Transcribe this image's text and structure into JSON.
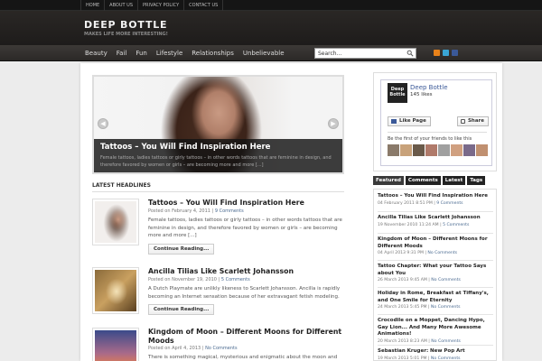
{
  "topnav": {
    "items": [
      "HOME",
      "ABOUT US",
      "PRIVACY POLICY",
      "CONTACT US"
    ]
  },
  "header": {
    "title": "DEEP BOTTLE",
    "tagline": "MAKES LIFE MORE INTERESTING!"
  },
  "mainnav": {
    "items": [
      "Beauty",
      "Fail",
      "Fun",
      "Lifestyle",
      "Relationships",
      "Unbelievable"
    ]
  },
  "search": {
    "placeholder": "Search..."
  },
  "social": {
    "icons": [
      "rss-icon",
      "twitter-icon",
      "facebook-icon"
    ],
    "colors": [
      "#e8821a",
      "#3aa6d6",
      "#3b5998"
    ]
  },
  "slider": {
    "title": "Tattoos – You Will Find Inspiration Here",
    "excerpt": "Female tattoos, ladies tattoos or girly tattoos – in other words tattoos that are feminine in design, and therefore favored by women or girls – are becoming more and more [...]"
  },
  "latest": {
    "heading": "LATEST HEADLINES"
  },
  "posts": [
    {
      "title": "Tattoos – You Will Find Inspiration Here",
      "date": "Posted on February 4, 2011",
      "comments": "9 Comments",
      "excerpt": "Female tattoos, ladies tattoos or girly tattoos – in other words tattoos that are feminine in design, and therefore favored by women or girls – are becoming more and more [...]",
      "more": "Continue Reading..."
    },
    {
      "title": "Ancilla Tilias Like Scarlett Johansson",
      "date": "Posted on November 19, 2010",
      "comments": "5 Comments",
      "excerpt": "A Dutch Playmate are unlikly likeness to Scarlett Johansson. Ancilla is rapidly becoming an Internet sensation because of her extravagant fetish modeling.",
      "more": "Continue Reading..."
    },
    {
      "title": "Kingdom of Moon – Different Moons for Different Moods",
      "date": "Posted on April 4, 2013",
      "comments": "No Comments",
      "excerpt": "There is something magical, mysterious and enigmatic about the moon and its"
    }
  ],
  "facebook": {
    "logo_line1": "Deep",
    "logo_line2": "Bottle",
    "name": "Deep Bottle",
    "likes": "145 likes",
    "like_button": "Like Page",
    "share_button": "Share",
    "friends_text": "Be the first of your friends to like this"
  },
  "tabs": [
    "Featured",
    "Comments",
    "Latest",
    "Tags"
  ],
  "sidebar_posts": [
    {
      "title": "Tattoos – You Will Find Inspiration Here",
      "date": "04 February 2011 8:51 PM",
      "comments": "9 Comments"
    },
    {
      "title": "Ancilla Tilias Like Scarlett Johansson",
      "date": "19 November 2010 11:24 AM",
      "comments": "5 Comments"
    },
    {
      "title": "Kingdom of Moon – Different Moons for Different Moods",
      "date": "04 April 2013 9:31 PM",
      "comments": "No Comments"
    },
    {
      "title": "Tattoo Chapter: What your Tattoo Says about You",
      "date": "26 March 2013 9:45 AM",
      "comments": "No Comments"
    },
    {
      "title": "Holiday in Rome, Breakfast at Tiffany's, and One Smile for Eternity",
      "date": "24 March 2013 5:45 PM",
      "comments": "No Comments"
    },
    {
      "title": "Crocodile on a Moppet, Dancing Hypo, Gay Lion... And Many More Awesome Animations!",
      "date": "20 March 2013 8:23 AM",
      "comments": "No Comments"
    },
    {
      "title": "Sebastian Kruger: New Pop Art",
      "date": "19 March 2013 5:01 PM",
      "comments": "No Comments"
    }
  ]
}
